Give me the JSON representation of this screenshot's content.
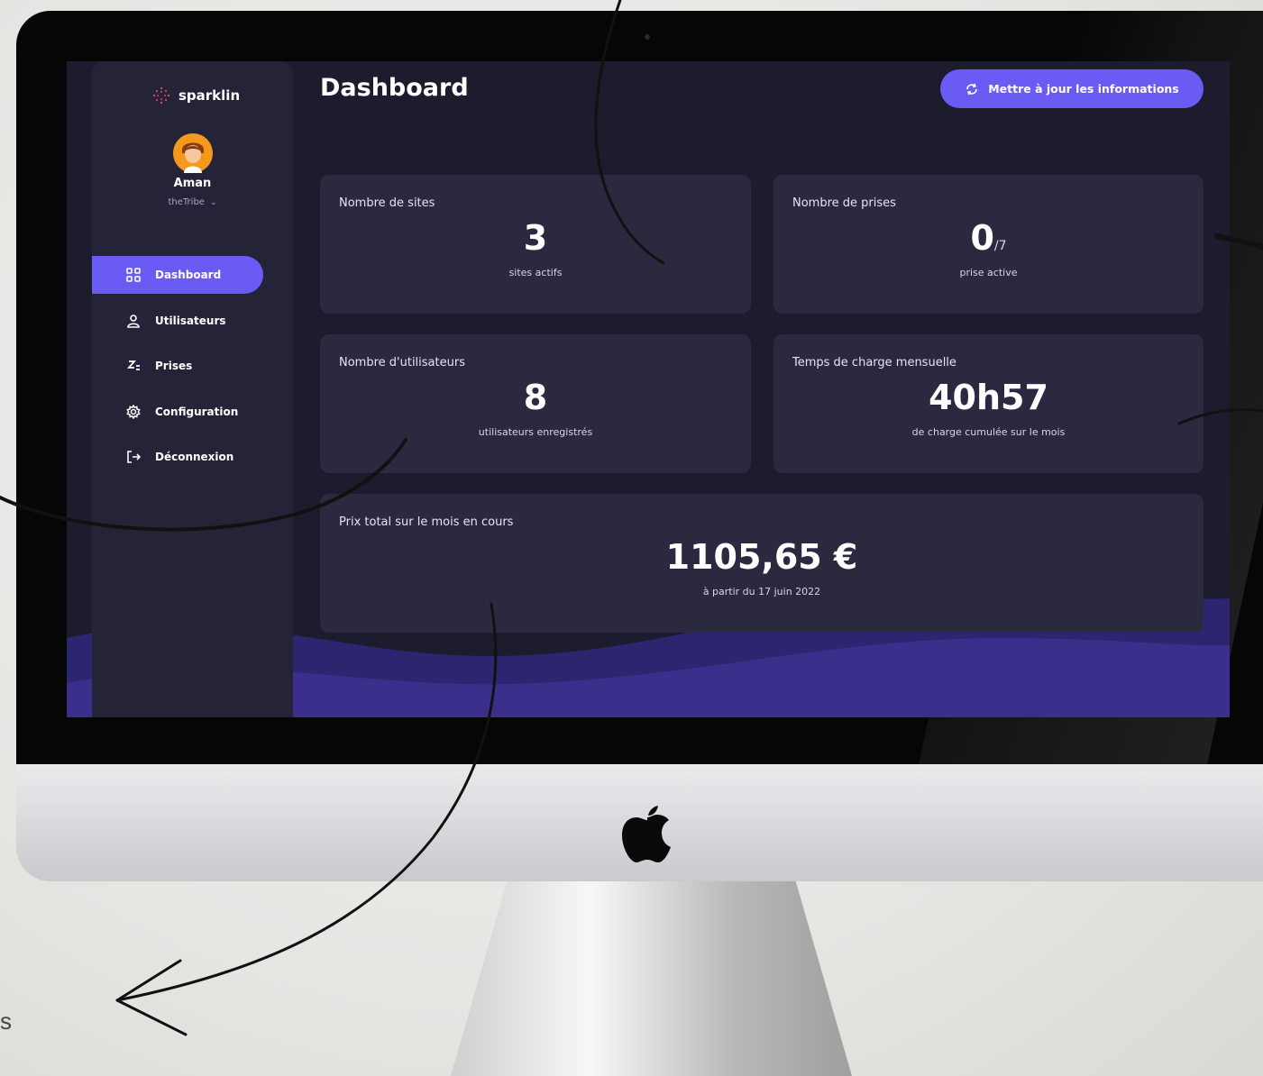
{
  "sidebar": {
    "brand": "sparklin",
    "user": {
      "name": "Aman",
      "org": "theTribe"
    },
    "items": [
      {
        "label": "Dashboard",
        "icon": "grid-icon",
        "active": true
      },
      {
        "label": "Utilisateurs",
        "icon": "user-icon",
        "active": false
      },
      {
        "label": "Prises",
        "icon": "plug-icon",
        "active": false
      },
      {
        "label": "Configuration",
        "icon": "gear-icon",
        "active": false
      },
      {
        "label": "Déconnexion",
        "icon": "logout-icon",
        "active": false
      }
    ]
  },
  "header": {
    "title": "Dashboard",
    "update_button": "Mettre à jour les informations"
  },
  "cards": {
    "sites": {
      "label": "Nombre de sites",
      "value": "3",
      "sub": "sites actifs"
    },
    "prises": {
      "label": "Nombre de prises",
      "value": "0",
      "of": "/7",
      "sub": "prise active"
    },
    "users": {
      "label": "Nombre d'utilisateurs",
      "value": "8",
      "sub": "utilisateurs enregistrés"
    },
    "charge": {
      "label": "Temps de charge mensuelle",
      "value": "40h57",
      "sub": "de charge cumulée sur le mois"
    },
    "price": {
      "label": "Prix total sur le mois en cours",
      "value": "1105,65 €",
      "sub": "à partir du 17 juin 2022"
    }
  },
  "colors": {
    "accent": "#6b5bf5",
    "screen_bg": "#1d1b2e",
    "card_bg": "#2b2940",
    "sidebar_bg": "#252338",
    "wave": "#3b2f8c"
  }
}
